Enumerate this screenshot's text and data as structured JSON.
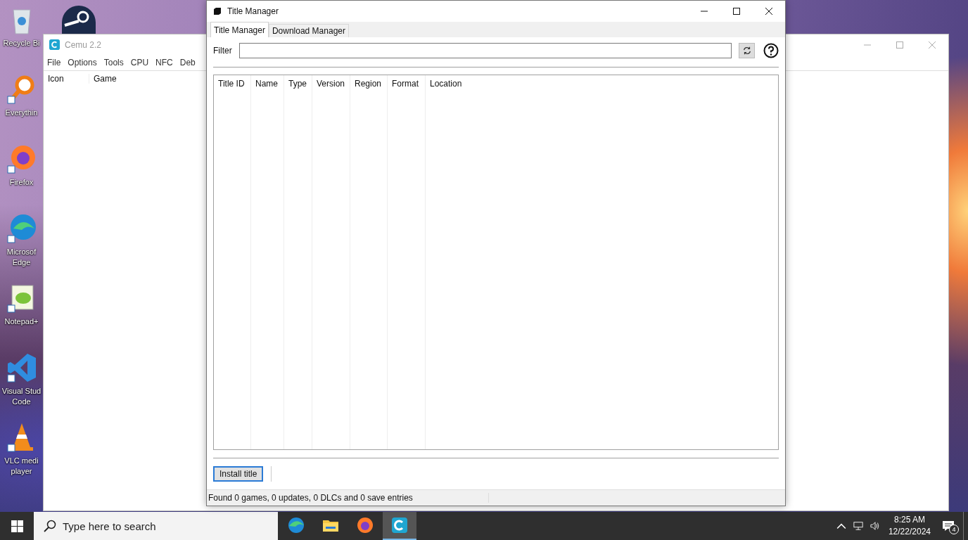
{
  "desktop_icons": [
    {
      "kind": "recycle",
      "label": "Recycle Bi"
    },
    {
      "kind": "everything",
      "label": "Everythin"
    },
    {
      "kind": "firefox",
      "label": "Firefox"
    },
    {
      "kind": "edge",
      "label": "Microsof Edge"
    },
    {
      "kind": "notepad",
      "label": "Notepad+"
    },
    {
      "kind": "vscode",
      "label": "Visual Stud Code"
    },
    {
      "kind": "vlc",
      "label": "VLC medi player"
    }
  ],
  "cemu_window": {
    "title": "Cemu 2.2",
    "menu": [
      "File",
      "Options",
      "Tools",
      "CPU",
      "NFC",
      "Deb"
    ],
    "columns": [
      "Icon",
      "Game"
    ]
  },
  "title_manager": {
    "title": "Title Manager",
    "tabs": [
      {
        "label": "Title Manager",
        "selected": true
      },
      {
        "label": "Download Manager",
        "selected": false
      }
    ],
    "filter_label": "Filter",
    "columns": [
      "Title ID",
      "Name",
      "Type",
      "Version",
      "Region",
      "Format",
      "Location"
    ],
    "install_button": "Install title",
    "status": "Found 0 games, 0 updates, 0 DLCs and 0 save entries"
  },
  "taskbar": {
    "search_placeholder": "Type here to search",
    "apps": [
      {
        "kind": "edge",
        "selected": false
      },
      {
        "kind": "folder",
        "selected": false
      },
      {
        "kind": "firefox",
        "selected": false
      },
      {
        "kind": "cemu",
        "selected": true
      }
    ],
    "time": "8:25 AM",
    "date": "12/22/2024",
    "notifications": "4"
  }
}
